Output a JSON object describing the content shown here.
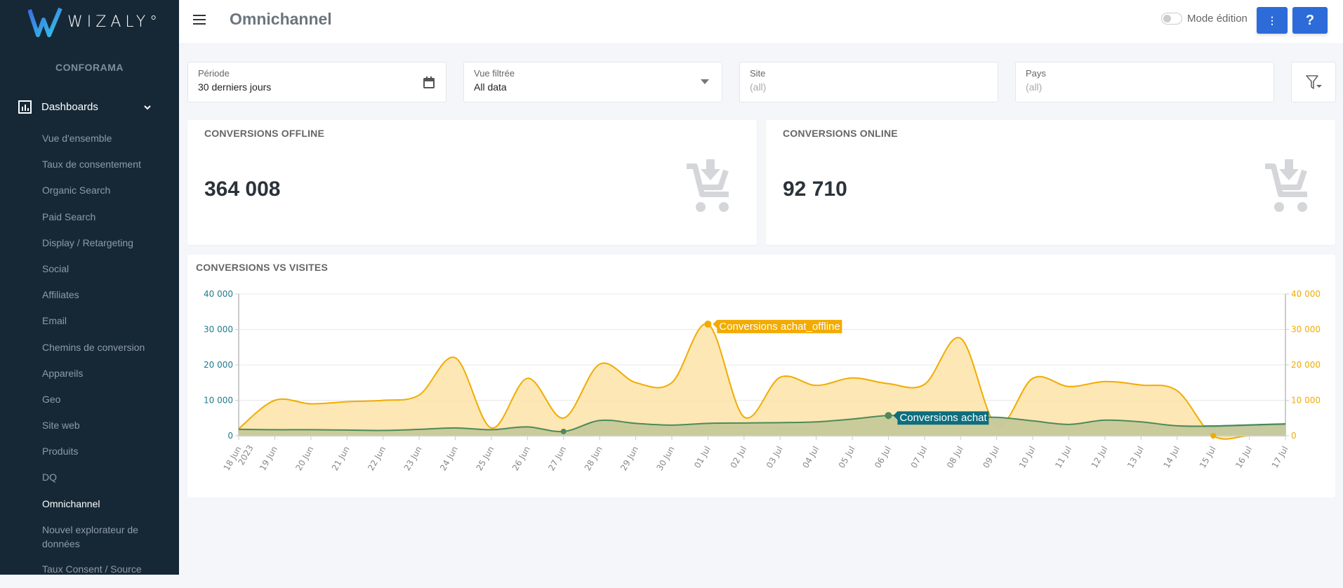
{
  "app": {
    "logo_text": "WIZALY°",
    "company": "CONFORAMA"
  },
  "sidebar": {
    "section_label": "Dashboards",
    "items": [
      {
        "label": "Vue d'ensemble"
      },
      {
        "label": "Taux de consentement"
      },
      {
        "label": "Organic Search"
      },
      {
        "label": "Paid Search"
      },
      {
        "label": "Display / Retargeting"
      },
      {
        "label": "Social"
      },
      {
        "label": "Affiliates"
      },
      {
        "label": "Email"
      },
      {
        "label": "Chemins de conversion"
      },
      {
        "label": "Appareils"
      },
      {
        "label": "Geo"
      },
      {
        "label": "Site web"
      },
      {
        "label": "Produits"
      },
      {
        "label": "DQ"
      },
      {
        "label": "Omnichannel",
        "active": true
      },
      {
        "label": "Nouvel explorateur de données"
      },
      {
        "label": "Taux Consent / Source"
      }
    ]
  },
  "header": {
    "title": "Omnichannel",
    "mode_edition_label": "Mode édition",
    "more_button_label": "⋮",
    "help_button_label": "?"
  },
  "filters": {
    "periode": {
      "label": "Période",
      "value": "30 derniers jours"
    },
    "vue": {
      "label": "Vue filtrée",
      "value": "All data"
    },
    "site": {
      "label": "Site",
      "value": "(all)"
    },
    "pays": {
      "label": "Pays",
      "value": "(all)"
    }
  },
  "kpis": {
    "offline": {
      "title": "CONVERSIONS OFFLINE",
      "value": "364 008",
      "icon": "cart-download-icon"
    },
    "online": {
      "title": "CONVERSIONS ONLINE",
      "value": "92 710",
      "icon": "cart-download-icon"
    }
  },
  "colors": {
    "accent": "#2d6bd8",
    "offline": "#f2ab00",
    "online": "#4d8a5a",
    "visits": "#0d6e7e"
  },
  "chart_data": {
    "type": "area",
    "title": "CONVERSIONS VS VISITES",
    "categories": [
      "18 Jun 2023",
      "19 Jun",
      "20 Jun",
      "21 Jun",
      "22 Jun",
      "23 Jun",
      "24 Jun",
      "25 Jun",
      "26 Jun",
      "27 Jun",
      "28 Jun",
      "29 Jun",
      "30 Jun",
      "01 Jul",
      "02 Jul",
      "03 Jul",
      "04 Jul",
      "05 Jul",
      "06 Jul",
      "07 Jul",
      "08 Jul",
      "09 Jul",
      "10 Jul",
      "11 Jul",
      "12 Jul",
      "13 Jul",
      "14 Jul",
      "15 Jul",
      "16 Jul",
      "17 Jul"
    ],
    "y_left": {
      "ticks": [
        "0",
        "10 000",
        "20 000",
        "30 000",
        "40 000"
      ],
      "range": [
        0,
        40000
      ]
    },
    "y_right": {
      "ticks": [
        "0",
        "10 000",
        "20 000",
        "30 000",
        "40 000"
      ],
      "range": [
        0,
        40000
      ]
    },
    "grid": true,
    "series": [
      {
        "name": "Conversions achat_offline",
        "axis": "right",
        "color": "#f2ab00",
        "values": [
          2000,
          10000,
          9000,
          9600,
          10000,
          11500,
          22000,
          2200,
          16200,
          5000,
          20200,
          15000,
          15000,
          31500,
          5300,
          16500,
          14200,
          16300,
          14700,
          14500,
          27500,
          3000,
          16200,
          13900,
          15300,
          14300,
          12700,
          0,
          0,
          0
        ],
        "label_at": "01 Jul"
      },
      {
        "name": "Conversions achat",
        "axis": "left",
        "color": "#4d8a5a",
        "values": [
          1800,
          1700,
          1700,
          1600,
          1500,
          1800,
          2200,
          1700,
          2500,
          1200,
          4300,
          3500,
          3000,
          3500,
          3600,
          3700,
          3900,
          4700,
          5700,
          5300,
          5000,
          5200,
          4200,
          3200,
          4400,
          3900,
          2800,
          2700,
          3000,
          3300
        ],
        "label_at": "06 Jul"
      }
    ]
  }
}
